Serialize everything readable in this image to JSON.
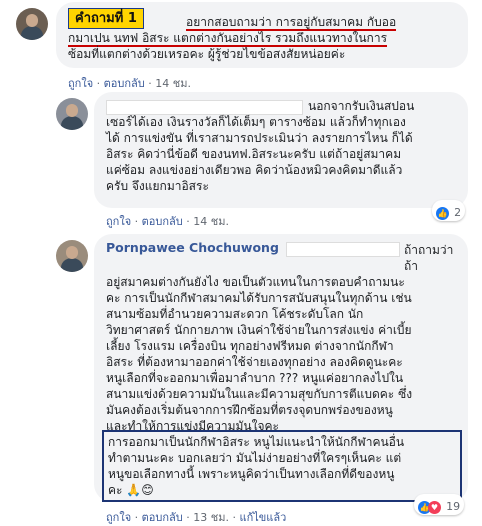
{
  "annotation": {
    "tag_label": "คำถามที่ 1"
  },
  "comment1": {
    "lines": [
      "อยากสอบถามว่า การอยู่กับสมาคม กับออ",
      "กมาเปน นทฟ อิสระ แตกต่างกันอย่างไร รวมถึงแนวทางในการ",
      "ซ้อมที่แตกต่างด้วยเหรอคะ ผู้รู้ช่วยไขข้อสงสัยหน่อยค่ะ"
    ],
    "actions": {
      "like": "ถูกใจ",
      "reply": "ตอบกลับ",
      "time": "14 ชม."
    }
  },
  "comment2": {
    "lines": [
      "นอกจากรับเงินสปอน",
      "เซอร์ได้เอง เงินรางวัลก็ได้เต็มๆ ตารางซ้อม แล้วก็ทำทุกเอง",
      "ได้ การแข่งขัน ที่เราสามารถประเมินว่า ลงรายการไหน ก็ได้",
      "อิสระ คิดว่านี่ข้อดี ของนทฟ.อิสระนะครับ แต่ถ้าอยู่สมาคม",
      "แค่ซ้อม ลงแข่งอย่างเดียวพอ คิดว่าน้องหมิวคงคิดมาดีแล้ว",
      "ครับ จึงแยกมาอิสระ"
    ],
    "actions": {
      "like": "ถูกใจ",
      "reply": "ตอบกลับ",
      "time": "14 ชม."
    },
    "reaction_count": "2"
  },
  "comment3": {
    "author": "Pornpawee Chochuwong",
    "lines": [
      "ถ้าถามว่า ถ้า",
      "อยู่สมาคมต่างกันยังไง ขอเป็นตัวแทนในการตอบคำถามนะ",
      "คะ การเป็นนักกีฬาสมาคมได้รับการสนับสนุนในทุกด้าน เช่น",
      "สนามซ้อมที่อำนวยความสะดวก โค้ชระดับโลก นัก",
      "วิทยาศาสตร์ นักกายภาพ เงินค่าใช้จ่ายในการส่งแข่ง ค่าเบี้ย",
      "เลี้ยง โรงแรม เครื่องบิน ทุกอย่างฟรีหมด ต่างจากนักกีฬา",
      "อิสระ ที่ต้องหามาออกค่าใช้จ่ายเองทุกอย่าง ลองคิดดูนะคะ",
      "หนูเลือกที่จะออกมาเพื่อมาลำบาก ??? หนูแค่อยากลงไปใน",
      "สนามแข่งด้วยความมันในและมีความสุขกับการตีแบดคะ ซึ่ง",
      "มันคงต้องเริ่มต้นจากการฝึกซ้อมที่ตรงจุดบกพร่องของหนู",
      "และทำให้การแข่งมีความมันใจคะ"
    ],
    "highlight_lines": [
      "การออกมาเป็นนักกีฬาอิสระ หนูไม่แนะนำให้นักกีฬาคนอื่น",
      "ทำตามนะคะ บอกเลยว่า มันไม่ง่ายอย่างที่ใครๆเห็นคะ แต่",
      "หนูขอเลือกทางนี้ เพราะหนูคิดว่าเป็นทางเลือกที่ดีของหนู",
      "คะ"
    ],
    "actions": {
      "like": "ถูกใจ",
      "reply": "ตอบกลับ",
      "time": "13 ชม.",
      "edited": "แก้ไขแล้ว"
    },
    "reaction_count": "19"
  }
}
